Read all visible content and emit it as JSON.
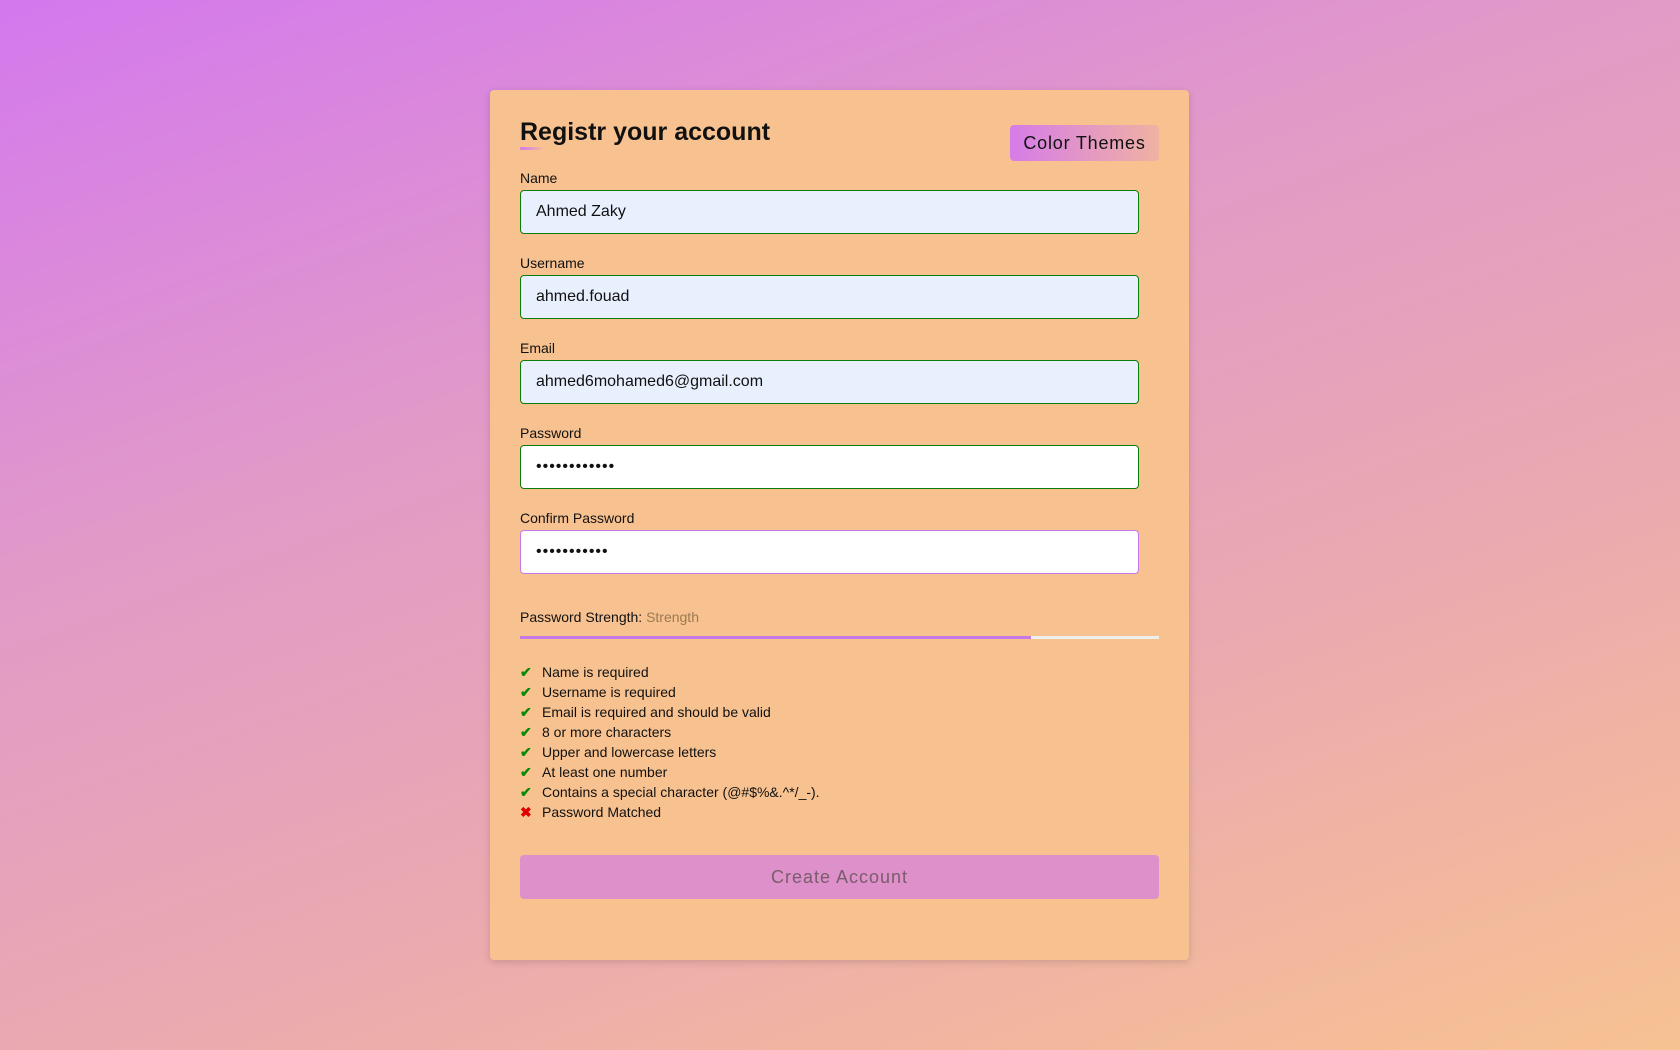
{
  "form": {
    "title": "Registr your account",
    "themes_label": "Color Themes",
    "fields": [
      {
        "label": "Name",
        "value": "Ahmed Zaky"
      },
      {
        "label": "Username",
        "value": "ahmed.fouad"
      },
      {
        "label": "Email",
        "value": "ahmed6mohamed6@gmail.com"
      },
      {
        "label": "Password",
        "value": "••••••••••••"
      },
      {
        "label": "Confirm Password",
        "value": "•••••••••••"
      }
    ],
    "strength_label": "Password Strength:",
    "strength_value": "Strength",
    "strength_percent": 80,
    "checks": [
      {
        "text": "Name is required",
        "ok": true
      },
      {
        "text": "Username is required",
        "ok": true
      },
      {
        "text": "Email is required and should be valid",
        "ok": true
      },
      {
        "text": "8 or more characters",
        "ok": true
      },
      {
        "text": "Upper and lowercase letters",
        "ok": true
      },
      {
        "text": "At least one number",
        "ok": true
      },
      {
        "text": "Contains a special character (@#$%&.^*/_-).",
        "ok": true
      },
      {
        "text": "Password Matched",
        "ok": false
      }
    ],
    "submit_label": "Create Account"
  },
  "colors": {
    "accent": "#c678e6",
    "valid": "#0a7d0a",
    "invalid": "#e00000",
    "card": "#f8c290"
  }
}
